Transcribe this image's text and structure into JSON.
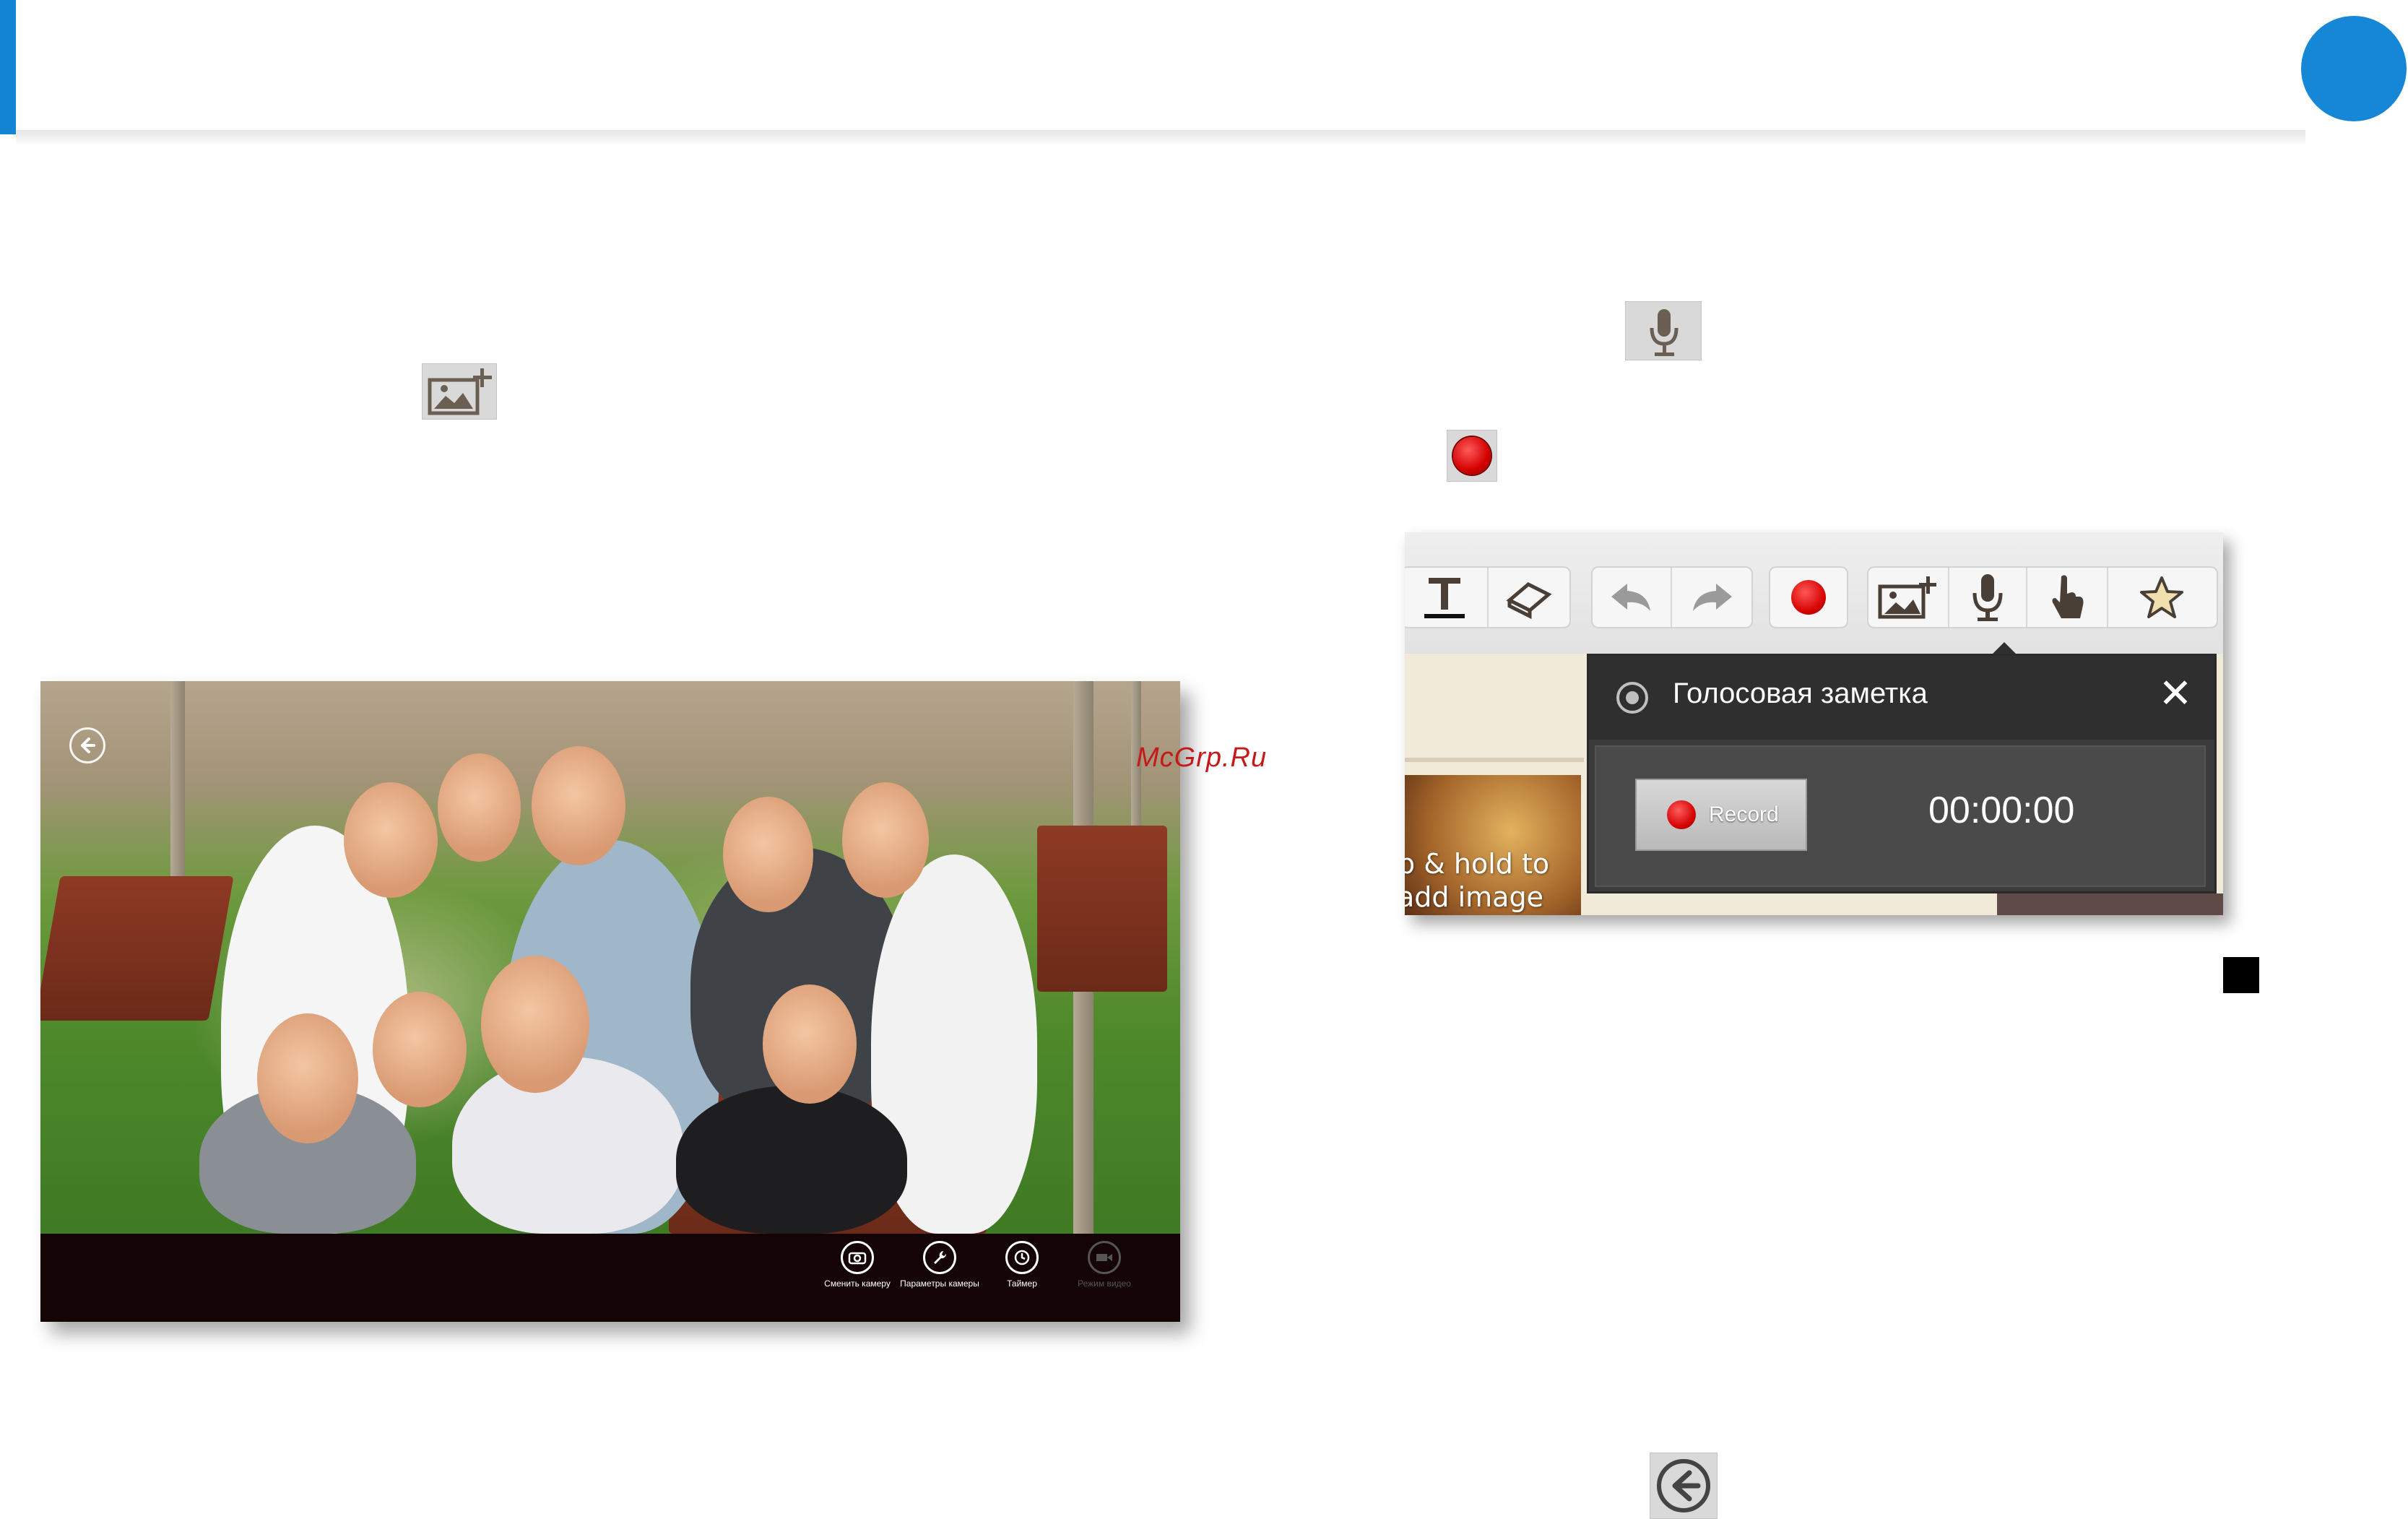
{
  "page": {
    "accent_color": "#1485d4"
  },
  "inline_icons": {
    "add_image": "add-image-icon",
    "microphone": "microphone-icon",
    "record": "record-icon",
    "back": "back-arrow-icon"
  },
  "camera_app": {
    "buttons": [
      {
        "label": "Сменить камеру",
        "icon": "switch-camera-icon",
        "enabled": true
      },
      {
        "label": "Параметры камеры",
        "icon": "wrench-icon",
        "enabled": true
      },
      {
        "label": "Таймер",
        "icon": "timer-icon",
        "enabled": true
      },
      {
        "label": "Режим видео",
        "icon": "video-camera-icon",
        "enabled": false
      }
    ]
  },
  "watermark": "McGrp.Ru",
  "notes_app": {
    "toolbar_icons": [
      "text-tool-icon",
      "eraser-icon",
      "undo-icon",
      "redo-icon",
      "record-icon",
      "add-image-icon",
      "microphone-icon",
      "hand-pointer-icon",
      "star-icon"
    ],
    "image_tile_text": "p & hold to\nadd image",
    "voice_memo": {
      "title": "Голосовая заметка",
      "record_label": "Record",
      "timer": "00:00:00",
      "record_color": "#d40000"
    }
  }
}
